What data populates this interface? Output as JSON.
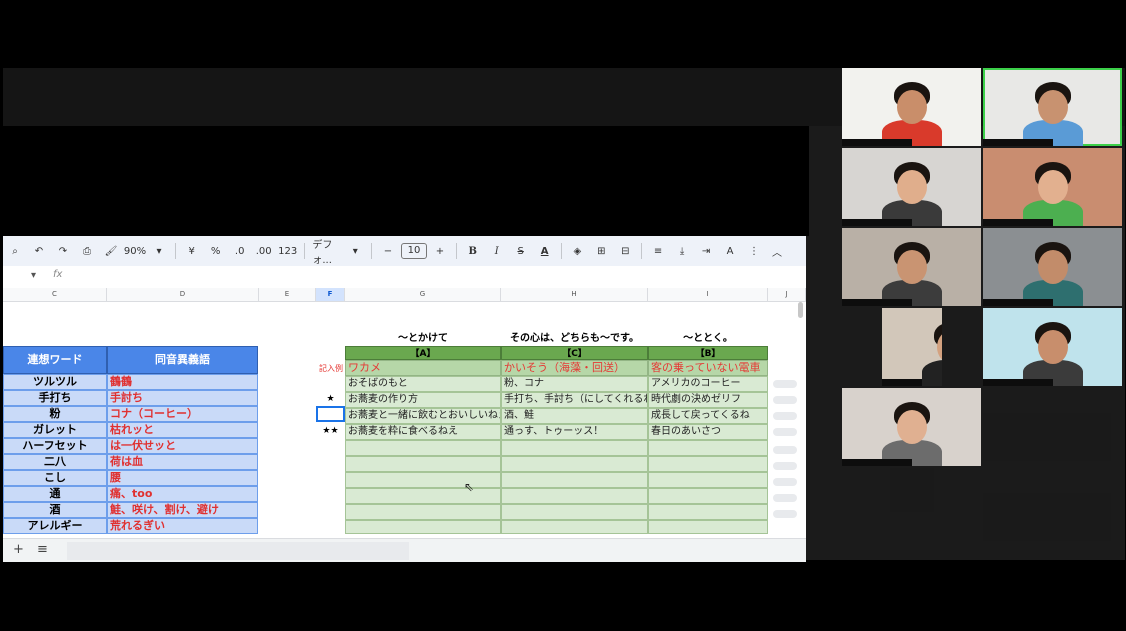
{
  "toolbar": {
    "zoom": "90%",
    "currency": "¥",
    "percent": "%",
    "dec_decrease": ".0",
    "dec_increase": ".00",
    "number_format": "123",
    "font": "デフォ...",
    "minus": "−",
    "font_size": "10",
    "plus": "+",
    "bold": "B",
    "italic": "I",
    "strike": "S",
    "text_color": "A",
    "text_color_b": "A"
  },
  "formula_bar": {
    "fx": "fx"
  },
  "columns": [
    "C",
    "D",
    "E",
    "F",
    "G",
    "H",
    "I",
    "J"
  ],
  "left_table": {
    "headers": [
      "連想ワード",
      "同音異義語"
    ],
    "rows": [
      {
        "word": "ツルツル",
        "homonym": "鶴鶴"
      },
      {
        "word": "手打ち",
        "homonym": "手討ち"
      },
      {
        "word": "粉",
        "homonym": "コナ（コーヒー）"
      },
      {
        "word": "ガレット",
        "homonym": "枯れッと"
      },
      {
        "word": "ハーフセット",
        "homonym": "は一伏せッと"
      },
      {
        "word": "二八",
        "homonym": "荷は血"
      },
      {
        "word": "こし",
        "homonym": "腰"
      },
      {
        "word": "通",
        "homonym": "痛、too"
      },
      {
        "word": "酒",
        "homonym": "鮭、咲け、割け、避け"
      },
      {
        "word": "アレルギー",
        "homonym": "荒れるぎい"
      }
    ]
  },
  "right_table": {
    "top_labels": [
      "〜とかけて",
      "その心は、どちらも〜です。",
      "〜ととく。"
    ],
    "headers": [
      "【A】",
      "【C】",
      "【B】"
    ],
    "example_label": "記入例",
    "example": [
      "ワカメ",
      "かいそう（海藻・回送）",
      "客の乗っていない電車"
    ],
    "rows": [
      {
        "mark": "",
        "a": "おそばのもと",
        "c": "粉、コナ",
        "b": "アメリカのコーヒー"
      },
      {
        "mark": "★",
        "a": "お蕎麦の作り方",
        "c": "手打ち、手討ち（にしてくれるわ）",
        "b": "時代劇の決めゼリフ"
      },
      {
        "mark": "",
        "a": "お蕎麦と一緒に飲むとおいしいねえ",
        "c": "酒、鮭",
        "b": "成長して戻ってくるね"
      },
      {
        "mark": "★★",
        "a": "お蕎麦を粋に食べるねえ",
        "c": "通っす、トゥーッス！",
        "b": "春日のあいさつ"
      }
    ]
  },
  "sheet_tabs": {
    "add": "+",
    "list": "≡"
  },
  "participants": [
    {
      "bg": "#f2f2ee",
      "skin": "#c98e6a",
      "shirt": "#d93a2b"
    },
    {
      "bg": "#e8e8e6",
      "skin": "#c89270",
      "shirt": "#5a9bd6"
    },
    {
      "bg": "#d7d5d2",
      "skin": "#e0ae8c",
      "shirt": "#3a3a3a"
    },
    {
      "bg": "#c98d70",
      "skin": "#e2b08f",
      "shirt": "#4caf50"
    },
    {
      "bg": "#b9b0a6",
      "skin": "#c99472",
      "shirt": "#3c3c3c"
    },
    {
      "bg": "#8b8f92",
      "skin": "#c28c6a",
      "shirt": "#2e6f6f"
    },
    {
      "bg": "#d2c7ba",
      "skin": "#d4a280",
      "shirt": "#222"
    },
    {
      "bg": "#bfe3ec",
      "skin": "#c88e6c",
      "shirt": "#3b3b3b"
    },
    {
      "bg": "#d8d2cc",
      "skin": "#e0b091",
      "shirt": "#6c6c6c"
    },
    {
      "bg": "#1a1a1a",
      "skin": "",
      "shirt": ""
    },
    {
      "bg": "#1a1a1a",
      "skin": "",
      "shirt": ""
    },
    {
      "bg": "#1a1a1a",
      "skin": "",
      "shirt": ""
    }
  ]
}
